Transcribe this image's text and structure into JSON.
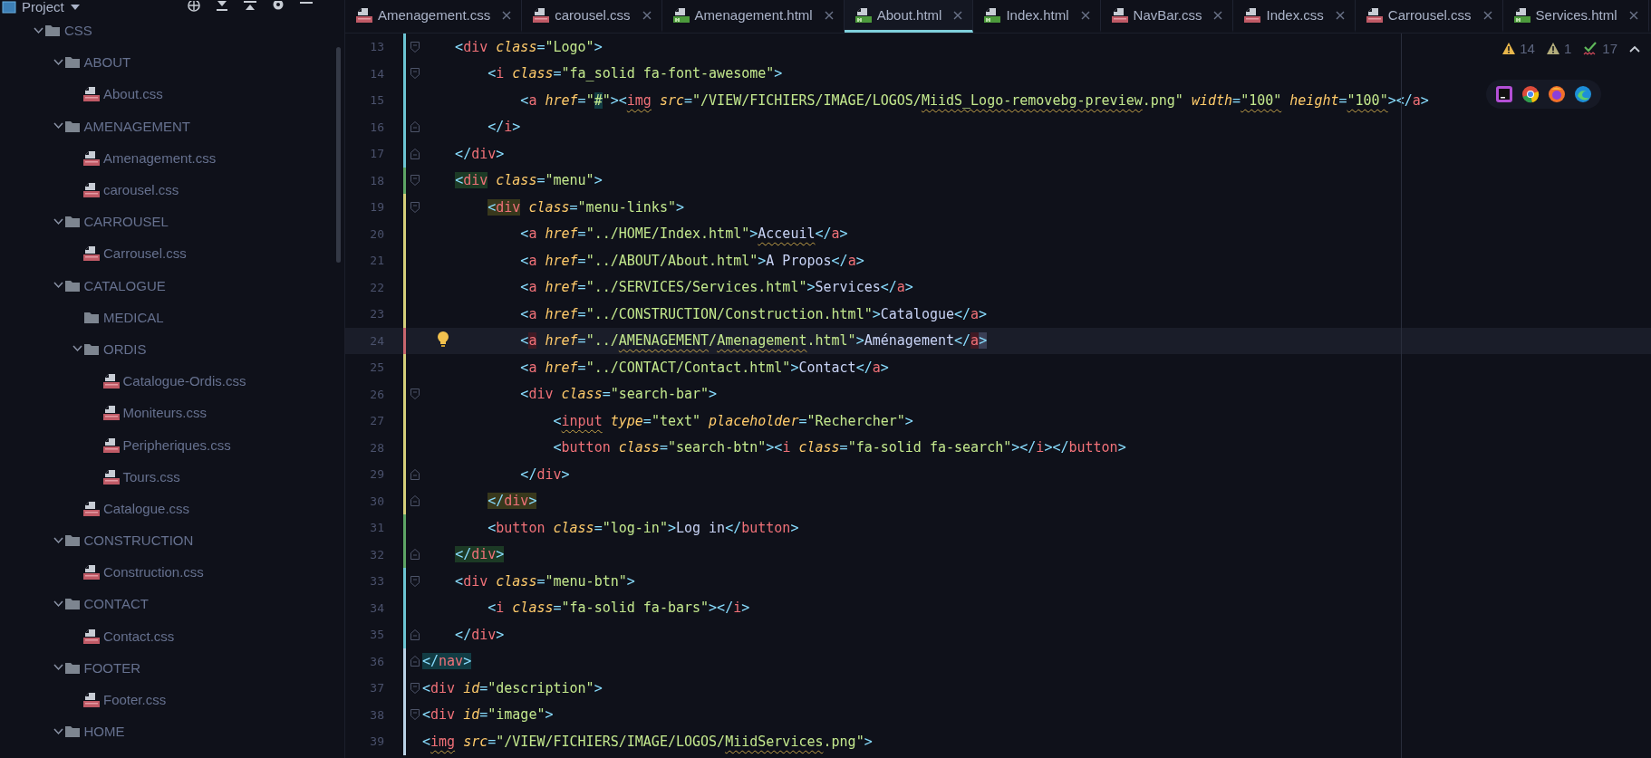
{
  "sidebar": {
    "title": "Project",
    "tree": [
      {
        "label": "CSS",
        "kind": "folder",
        "expanded": true,
        "children": [
          {
            "label": "ABOUT",
            "kind": "folder",
            "expanded": true,
            "children": [
              {
                "label": "About.css",
                "kind": "css"
              }
            ]
          },
          {
            "label": "AMENAGEMENT",
            "kind": "folder",
            "expanded": true,
            "children": [
              {
                "label": "Amenagement.css",
                "kind": "css"
              },
              {
                "label": "carousel.css",
                "kind": "css"
              }
            ]
          },
          {
            "label": "CARROUSEL",
            "kind": "folder",
            "expanded": true,
            "children": [
              {
                "label": "Carrousel.css",
                "kind": "css"
              }
            ]
          },
          {
            "label": "CATALOGUE",
            "kind": "folder",
            "expanded": true,
            "children": [
              {
                "label": "MEDICAL",
                "kind": "folder"
              },
              {
                "label": "ORDIS",
                "kind": "folder",
                "expanded": true,
                "children": [
                  {
                    "label": "Catalogue-Ordis.css",
                    "kind": "css"
                  },
                  {
                    "label": "Moniteurs.css",
                    "kind": "css"
                  },
                  {
                    "label": "Peripheriques.css",
                    "kind": "css"
                  },
                  {
                    "label": "Tours.css",
                    "kind": "css"
                  }
                ]
              },
              {
                "label": "Catalogue.css",
                "kind": "css"
              }
            ]
          },
          {
            "label": "CONSTRUCTION",
            "kind": "folder",
            "expanded": true,
            "children": [
              {
                "label": "Construction.css",
                "kind": "css"
              }
            ]
          },
          {
            "label": "CONTACT",
            "kind": "folder",
            "expanded": true,
            "children": [
              {
                "label": "Contact.css",
                "kind": "css"
              }
            ]
          },
          {
            "label": "FOOTER",
            "kind": "folder",
            "expanded": true,
            "children": [
              {
                "label": "Footer.css",
                "kind": "css"
              }
            ]
          },
          {
            "label": "HOME",
            "kind": "folder",
            "expanded": true
          }
        ]
      }
    ]
  },
  "tabs": [
    {
      "label": "Amenagement.css",
      "kind": "css",
      "selected": false
    },
    {
      "label": "carousel.css",
      "kind": "css",
      "selected": false
    },
    {
      "label": "Amenagement.html",
      "kind": "html",
      "selected": false
    },
    {
      "label": "About.html",
      "kind": "html",
      "selected": true
    },
    {
      "label": "Index.html",
      "kind": "html",
      "selected": false
    },
    {
      "label": "NavBar.css",
      "kind": "css",
      "selected": false
    },
    {
      "label": "Index.css",
      "kind": "css",
      "selected": false
    },
    {
      "label": "Carrousel.css",
      "kind": "css",
      "selected": false
    },
    {
      "label": "Services.html",
      "kind": "html",
      "selected": false
    }
  ],
  "editor": {
    "inspections": [
      {
        "kind": "warning",
        "count": "14"
      },
      {
        "kind": "weak_warning",
        "count": "1"
      },
      {
        "kind": "typo",
        "count": "17"
      }
    ],
    "lines": [
      {
        "number": "13",
        "color": "#6cc5d4",
        "fold_start": true,
        "fold_end": false,
        "current": false,
        "tokens": [
          {
            "kind": "punct",
            "text": "    <"
          },
          {
            "kind": "tag",
            "text": "div"
          },
          {
            "kind": "attr",
            "text": " class"
          },
          {
            "kind": "punct",
            "text": "="
          },
          {
            "kind": "string",
            "text": "\"Logo\""
          },
          {
            "kind": "punct",
            "text": ">"
          }
        ]
      },
      {
        "number": "14",
        "color": "#6cc5d4",
        "fold_start": true,
        "fold_end": false,
        "current": false,
        "tokens": [
          {
            "kind": "punct",
            "text": "        <"
          },
          {
            "kind": "tag",
            "text": "i"
          },
          {
            "kind": "attr",
            "text": " class"
          },
          {
            "kind": "punct",
            "text": "="
          },
          {
            "kind": "string",
            "text": "\"fa_solid fa-font-awesome\""
          },
          {
            "kind": "punct",
            "text": ">"
          }
        ]
      },
      {
        "number": "15",
        "color": "#6cc5d4",
        "fold_start": false,
        "fold_end": false,
        "current": false,
        "tokens": [
          {
            "kind": "punct",
            "text": "            <"
          },
          {
            "kind": "tag",
            "text": "a"
          },
          {
            "kind": "attr",
            "text": " href"
          },
          {
            "kind": "punct",
            "text": "="
          },
          {
            "kind": "string",
            "text": "\""
          },
          {
            "kind": "string",
            "text": "#",
            "color": "#123c44"
          },
          {
            "kind": "string",
            "text": "\""
          },
          {
            "kind": "punct",
            "text": "><"
          },
          {
            "kind": "tag",
            "text": "img",
            "warning": true
          },
          {
            "kind": "attr",
            "text": " src"
          },
          {
            "kind": "punct",
            "text": "="
          },
          {
            "kind": "string",
            "text": "\"/VIEW/FICHIERS/IMAGE/LOGOS/"
          },
          {
            "kind": "string",
            "text": "MiidS_Logo-removebg-preview",
            "warning": true
          },
          {
            "kind": "string",
            "text": ".png\""
          },
          {
            "kind": "attr",
            "text": " width"
          },
          {
            "kind": "punct",
            "text": "="
          },
          {
            "kind": "string",
            "text": "\"100\"",
            "warning": true
          },
          {
            "kind": "attr",
            "text": " height"
          },
          {
            "kind": "punct",
            "text": "="
          },
          {
            "kind": "string",
            "text": "\"100\"",
            "warning": true
          },
          {
            "kind": "punct",
            "text": "></"
          },
          {
            "kind": "tag",
            "text": "a"
          },
          {
            "kind": "punct",
            "text": ">"
          }
        ]
      },
      {
        "number": "16",
        "color": "#6cc5d4",
        "fold_start": false,
        "fold_end": true,
        "current": false,
        "tokens": [
          {
            "kind": "punct",
            "text": "        </"
          },
          {
            "kind": "tag",
            "text": "i"
          },
          {
            "kind": "punct",
            "text": ">"
          }
        ]
      },
      {
        "number": "17",
        "color": "#6cc5d4",
        "fold_start": false,
        "fold_end": true,
        "current": false,
        "tokens": [
          {
            "kind": "punct",
            "text": "    </"
          },
          {
            "kind": "tag",
            "text": "div"
          },
          {
            "kind": "punct",
            "text": ">"
          }
        ]
      },
      {
        "number": "18",
        "color": "#5da565",
        "fold_start": true,
        "fold_end": false,
        "current": false,
        "tokens": [
          {
            "kind": "punct",
            "text": "    <",
            "color": "#1c3a25"
          },
          {
            "kind": "tag",
            "text": "div",
            "color": "#1c3a25"
          },
          {
            "kind": "attr",
            "text": " class"
          },
          {
            "kind": "punct",
            "text": "="
          },
          {
            "kind": "string",
            "text": "\"menu\""
          },
          {
            "kind": "punct",
            "text": ">"
          }
        ]
      },
      {
        "number": "19",
        "color": "#d5cf7a",
        "fold_start": true,
        "fold_end": false,
        "current": false,
        "tokens": [
          {
            "kind": "punct",
            "text": "        <",
            "color": "#38381c"
          },
          {
            "kind": "tag",
            "text": "div",
            "color": "#38381c"
          },
          {
            "kind": "attr",
            "text": " class"
          },
          {
            "kind": "punct",
            "text": "="
          },
          {
            "kind": "string",
            "text": "\"menu-links\""
          },
          {
            "kind": "punct",
            "text": ">"
          }
        ]
      },
      {
        "number": "20",
        "color": "#d5cf7a",
        "fold_start": false,
        "fold_end": false,
        "current": false,
        "tokens": [
          {
            "kind": "punct",
            "text": "            <"
          },
          {
            "kind": "tag",
            "text": "a"
          },
          {
            "kind": "attr",
            "text": " href"
          },
          {
            "kind": "punct",
            "text": "="
          },
          {
            "kind": "string",
            "text": "\"../HOME/Index.html\""
          },
          {
            "kind": "punct",
            "text": ">"
          },
          {
            "kind": "text",
            "text": "Acceuil",
            "warning": true
          },
          {
            "kind": "punct",
            "text": "</"
          },
          {
            "kind": "tag",
            "text": "a"
          },
          {
            "kind": "punct",
            "text": ">"
          }
        ]
      },
      {
        "number": "21",
        "color": "#d5cf7a",
        "fold_start": false,
        "fold_end": false,
        "current": false,
        "tokens": [
          {
            "kind": "punct",
            "text": "            <"
          },
          {
            "kind": "tag",
            "text": "a"
          },
          {
            "kind": "attr",
            "text": " href"
          },
          {
            "kind": "punct",
            "text": "="
          },
          {
            "kind": "string",
            "text": "\"../ABOUT/About.html\""
          },
          {
            "kind": "punct",
            "text": ">"
          },
          {
            "kind": "text",
            "text": "A Propos"
          },
          {
            "kind": "punct",
            "text": "</"
          },
          {
            "kind": "tag",
            "text": "a"
          },
          {
            "kind": "punct",
            "text": ">"
          }
        ]
      },
      {
        "number": "22",
        "color": "#d5cf7a",
        "fold_start": false,
        "fold_end": false,
        "current": false,
        "tokens": [
          {
            "kind": "punct",
            "text": "            <"
          },
          {
            "kind": "tag",
            "text": "a"
          },
          {
            "kind": "attr",
            "text": " href"
          },
          {
            "kind": "punct",
            "text": "="
          },
          {
            "kind": "string",
            "text": "\"../SERVICES/Services.html\""
          },
          {
            "kind": "punct",
            "text": ">"
          },
          {
            "kind": "text",
            "text": "Services"
          },
          {
            "kind": "punct",
            "text": "</"
          },
          {
            "kind": "tag",
            "text": "a"
          },
          {
            "kind": "punct",
            "text": ">"
          }
        ]
      },
      {
        "number": "23",
        "color": "#d5cf7a",
        "fold_start": false,
        "fold_end": false,
        "current": false,
        "tokens": [
          {
            "kind": "punct",
            "text": "            <"
          },
          {
            "kind": "tag",
            "text": "a"
          },
          {
            "kind": "attr",
            "text": " href"
          },
          {
            "kind": "punct",
            "text": "="
          },
          {
            "kind": "string",
            "text": "\"../CONSTRUCTION/Construction.html\""
          },
          {
            "kind": "punct",
            "text": ">"
          },
          {
            "kind": "text",
            "text": "Catalogue"
          },
          {
            "kind": "punct",
            "text": "</"
          },
          {
            "kind": "tag",
            "text": "a"
          },
          {
            "kind": "punct",
            "text": ">"
          }
        ]
      },
      {
        "number": "24",
        "color": "#c8666e",
        "fold_start": false,
        "fold_end": false,
        "current": true,
        "tokens": [
          {
            "kind": "punct",
            "text": "            <"
          },
          {
            "kind": "tag",
            "text": "a",
            "color": "#3f1a24"
          },
          {
            "kind": "attr",
            "text": " href"
          },
          {
            "kind": "punct",
            "text": "="
          },
          {
            "kind": "string",
            "text": "\"../"
          },
          {
            "kind": "string",
            "text": "AMENAGEMENT",
            "warning": true
          },
          {
            "kind": "string",
            "text": "/"
          },
          {
            "kind": "string",
            "text": "Amenagement",
            "warning": true
          },
          {
            "kind": "string",
            "text": ".html\""
          },
          {
            "kind": "punct",
            "text": ">"
          },
          {
            "kind": "text",
            "text": "Aménagement"
          },
          {
            "kind": "punct",
            "text": "</"
          },
          {
            "kind": "tag",
            "text": "a",
            "color": "#3f1a24"
          },
          {
            "kind": "punct",
            "text": ">",
            "color": "#3a3f55"
          }
        ]
      },
      {
        "number": "25",
        "color": "#d5cf7a",
        "fold_start": false,
        "fold_end": false,
        "current": false,
        "tokens": [
          {
            "kind": "punct",
            "text": "            <"
          },
          {
            "kind": "tag",
            "text": "a"
          },
          {
            "kind": "attr",
            "text": " href"
          },
          {
            "kind": "punct",
            "text": "="
          },
          {
            "kind": "string",
            "text": "\"../CONTACT/Contact.html\""
          },
          {
            "kind": "punct",
            "text": ">"
          },
          {
            "kind": "text",
            "text": "Contact"
          },
          {
            "kind": "punct",
            "text": "</"
          },
          {
            "kind": "tag",
            "text": "a"
          },
          {
            "kind": "punct",
            "text": ">"
          }
        ]
      },
      {
        "number": "26",
        "color": "#d5cf7a",
        "fold_start": true,
        "fold_end": false,
        "current": false,
        "tokens": [
          {
            "kind": "punct",
            "text": "            <"
          },
          {
            "kind": "tag",
            "text": "div"
          },
          {
            "kind": "attr",
            "text": " class"
          },
          {
            "kind": "punct",
            "text": "="
          },
          {
            "kind": "string",
            "text": "\"search-bar\""
          },
          {
            "kind": "punct",
            "text": ">"
          }
        ]
      },
      {
        "number": "27",
        "color": "#d5cf7a",
        "fold_start": false,
        "fold_end": false,
        "current": false,
        "tokens": [
          {
            "kind": "punct",
            "text": "                <"
          },
          {
            "kind": "tag",
            "text": "input",
            "warning": true
          },
          {
            "kind": "attr",
            "text": " type"
          },
          {
            "kind": "punct",
            "text": "="
          },
          {
            "kind": "string",
            "text": "\"text\""
          },
          {
            "kind": "attr",
            "text": " placeholder"
          },
          {
            "kind": "punct",
            "text": "="
          },
          {
            "kind": "string",
            "text": "\"Rechercher\""
          },
          {
            "kind": "punct",
            "text": ">"
          }
        ]
      },
      {
        "number": "28",
        "color": "#d5cf7a",
        "fold_start": false,
        "fold_end": false,
        "current": false,
        "tokens": [
          {
            "kind": "punct",
            "text": "                <"
          },
          {
            "kind": "tag",
            "text": "button"
          },
          {
            "kind": "attr",
            "text": " class"
          },
          {
            "kind": "punct",
            "text": "="
          },
          {
            "kind": "string",
            "text": "\"search-btn\""
          },
          {
            "kind": "punct",
            "text": "><"
          },
          {
            "kind": "tag",
            "text": "i"
          },
          {
            "kind": "attr",
            "text": " class"
          },
          {
            "kind": "punct",
            "text": "="
          },
          {
            "kind": "string",
            "text": "\"fa-solid fa-search\""
          },
          {
            "kind": "punct",
            "text": "></"
          },
          {
            "kind": "tag",
            "text": "i"
          },
          {
            "kind": "punct",
            "text": "></"
          },
          {
            "kind": "tag",
            "text": "button"
          },
          {
            "kind": "punct",
            "text": ">"
          }
        ]
      },
      {
        "number": "29",
        "color": "#d5cf7a",
        "fold_start": false,
        "fold_end": true,
        "current": false,
        "tokens": [
          {
            "kind": "punct",
            "text": "            </"
          },
          {
            "kind": "tag",
            "text": "div"
          },
          {
            "kind": "punct",
            "text": ">"
          }
        ]
      },
      {
        "number": "30",
        "color": "#d5cf7a",
        "fold_start": false,
        "fold_end": true,
        "current": false,
        "tokens": [
          {
            "kind": "punct",
            "text": "        </",
            "color": "#38381c"
          },
          {
            "kind": "tag",
            "text": "div",
            "color": "#38381c"
          },
          {
            "kind": "punct",
            "text": ">",
            "color": "#38381c"
          }
        ]
      },
      {
        "number": "31",
        "color": "#5da565",
        "fold_start": false,
        "fold_end": false,
        "current": false,
        "tokens": [
          {
            "kind": "punct",
            "text": "        <"
          },
          {
            "kind": "tag",
            "text": "button"
          },
          {
            "kind": "attr",
            "text": " class"
          },
          {
            "kind": "punct",
            "text": "="
          },
          {
            "kind": "string",
            "text": "\"log-in\""
          },
          {
            "kind": "punct",
            "text": ">"
          },
          {
            "kind": "text",
            "text": "Log in"
          },
          {
            "kind": "punct",
            "text": "</"
          },
          {
            "kind": "tag",
            "text": "button"
          },
          {
            "kind": "punct",
            "text": ">"
          }
        ]
      },
      {
        "number": "32",
        "color": "#5da565",
        "fold_start": false,
        "fold_end": true,
        "current": false,
        "tokens": [
          {
            "kind": "punct",
            "text": "    </",
            "color": "#1c3a25"
          },
          {
            "kind": "tag",
            "text": "div",
            "color": "#1c3a25"
          },
          {
            "kind": "punct",
            "text": ">",
            "color": "#1c3a25"
          }
        ]
      },
      {
        "number": "33",
        "color": "#6cc5d4",
        "fold_start": true,
        "fold_end": false,
        "current": false,
        "tokens": [
          {
            "kind": "punct",
            "text": "    <"
          },
          {
            "kind": "tag",
            "text": "div"
          },
          {
            "kind": "attr",
            "text": " class"
          },
          {
            "kind": "punct",
            "text": "="
          },
          {
            "kind": "string",
            "text": "\"menu-btn\""
          },
          {
            "kind": "punct",
            "text": ">"
          }
        ]
      },
      {
        "number": "34",
        "color": "#6cc5d4",
        "fold_start": false,
        "fold_end": false,
        "current": false,
        "tokens": [
          {
            "kind": "punct",
            "text": "        <"
          },
          {
            "kind": "tag",
            "text": "i"
          },
          {
            "kind": "attr",
            "text": " class"
          },
          {
            "kind": "punct",
            "text": "="
          },
          {
            "kind": "string",
            "text": "\"fa-solid fa-bars\""
          },
          {
            "kind": "punct",
            "text": "></"
          },
          {
            "kind": "tag",
            "text": "i"
          },
          {
            "kind": "punct",
            "text": ">"
          }
        ]
      },
      {
        "number": "35",
        "color": "#6cc5d4",
        "fold_start": false,
        "fold_end": true,
        "current": false,
        "tokens": [
          {
            "kind": "punct",
            "text": "    </"
          },
          {
            "kind": "tag",
            "text": "div"
          },
          {
            "kind": "punct",
            "text": ">"
          }
        ]
      },
      {
        "number": "36",
        "color": "#b9d2e6",
        "fold_start": false,
        "fold_end": true,
        "current": false,
        "tokens": [
          {
            "kind": "punct",
            "text": "</",
            "color": "#123c44"
          },
          {
            "kind": "tag",
            "text": "nav",
            "color": "#123c44"
          },
          {
            "kind": "punct",
            "text": ">",
            "color": "#123c44"
          }
        ]
      },
      {
        "number": "37",
        "color": "#b9d2e6",
        "fold_start": true,
        "fold_end": false,
        "current": false,
        "tokens": [
          {
            "kind": "punct",
            "text": "<"
          },
          {
            "kind": "tag",
            "text": "div"
          },
          {
            "kind": "attr",
            "text": " id"
          },
          {
            "kind": "punct",
            "text": "="
          },
          {
            "kind": "string",
            "text": "\"description\""
          },
          {
            "kind": "punct",
            "text": ">"
          }
        ]
      },
      {
        "number": "38",
        "color": "#b9d2e6",
        "fold_start": true,
        "fold_end": false,
        "current": false,
        "tokens": [
          {
            "kind": "punct",
            "text": "<"
          },
          {
            "kind": "tag",
            "text": "div"
          },
          {
            "kind": "attr",
            "text": " id"
          },
          {
            "kind": "punct",
            "text": "="
          },
          {
            "kind": "string",
            "text": "\"image\""
          },
          {
            "kind": "punct",
            "text": ">"
          }
        ]
      },
      {
        "number": "39",
        "color": "#b9d2e6",
        "fold_start": false,
        "fold_end": false,
        "current": false,
        "tokens": [
          {
            "kind": "punct",
            "text": "<"
          },
          {
            "kind": "tag",
            "text": "img",
            "warning": true
          },
          {
            "kind": "attr",
            "text": " src"
          },
          {
            "kind": "punct",
            "text": "="
          },
          {
            "kind": "string",
            "text": "\"/VIEW/FICHIERS/IMAGE/LOGOS/"
          },
          {
            "kind": "string",
            "text": "MiidServices",
            "warning": true
          },
          {
            "kind": "string",
            "text": ".png\""
          },
          {
            "kind": "punct",
            "text": ">"
          }
        ]
      }
    ]
  }
}
